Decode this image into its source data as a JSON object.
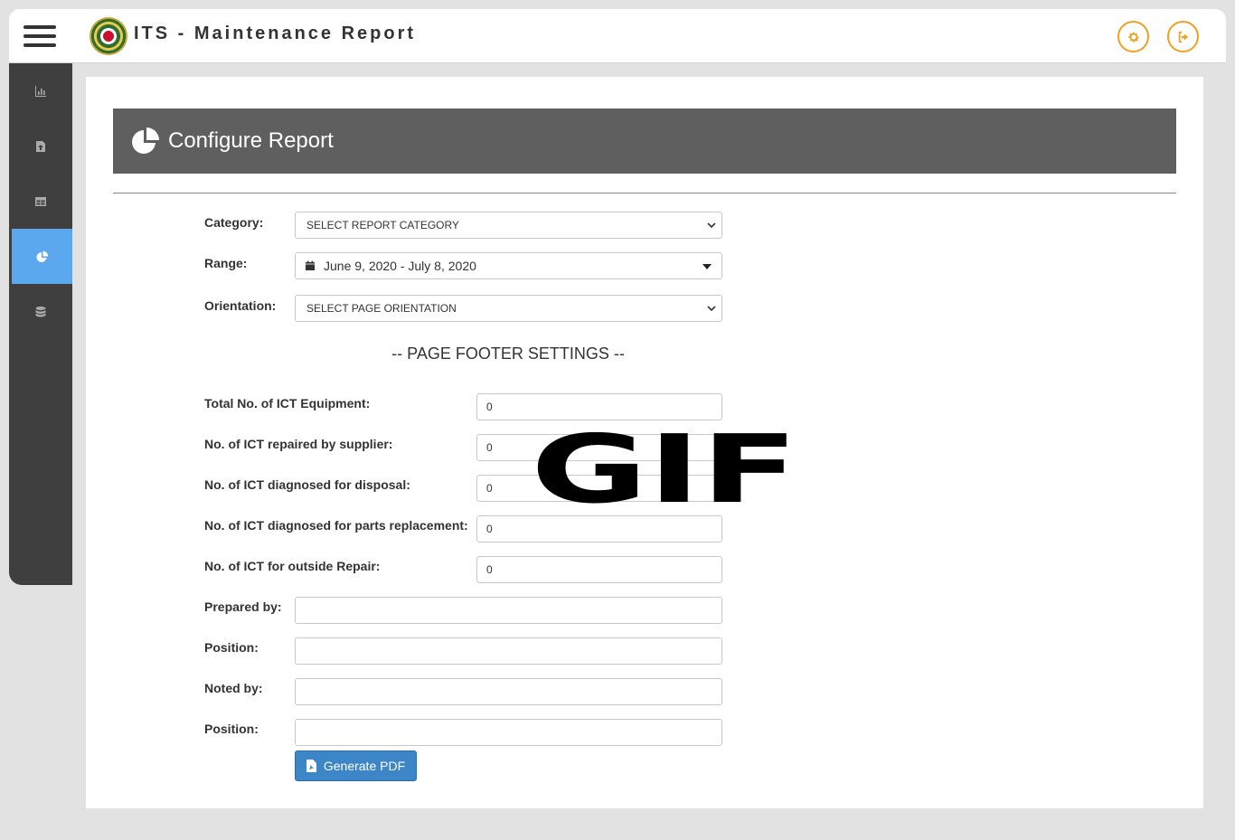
{
  "app": {
    "title": "ITS - Maintenance Report"
  },
  "icons": {
    "menu": "hamburger-menu-icon",
    "settings": "gear-icon",
    "logout": "sign-out-icon",
    "sidebar": [
      "bar-chart-icon",
      "file-upload-icon",
      "table-icon",
      "pie-chart-icon",
      "database-icon"
    ]
  },
  "panel": {
    "title": "Configure Report"
  },
  "form": {
    "category": {
      "label": "Category:",
      "value": "SELECT REPORT CATEGORY"
    },
    "range": {
      "label": "Range:",
      "value": "June 9, 2020 - July 8, 2020"
    },
    "orientation": {
      "label": "Orientation:",
      "value": "SELECT PAGE ORIENTATION"
    },
    "footer_heading": "-- PAGE FOOTER SETTINGS --",
    "footer_fields": [
      {
        "label": "Total No. of ICT Equipment:",
        "value": "0"
      },
      {
        "label": "No. of ICT repaired by supplier:",
        "value": "0"
      },
      {
        "label": "No. of ICT diagnosed for disposal:",
        "value": "0"
      },
      {
        "label": "No. of ICT diagnosed for parts replacement:",
        "value": "0"
      },
      {
        "label": "No. of ICT for outside Repair:",
        "value": "0"
      }
    ],
    "signatories": [
      {
        "label": "Prepared by:",
        "value": ""
      },
      {
        "label": "Position:",
        "value": ""
      },
      {
        "label": "Noted by:",
        "value": ""
      },
      {
        "label": "Position:",
        "value": ""
      }
    ],
    "generate_label": "Generate PDF"
  },
  "overlay": {
    "text": "GIF"
  },
  "colors": {
    "accent": "#f0a020",
    "sidebar_bg": "#3f3f3f",
    "sidebar_active": "#5ba8ef",
    "header_bg": "#5f5f5f",
    "button": "#3c86c8"
  }
}
